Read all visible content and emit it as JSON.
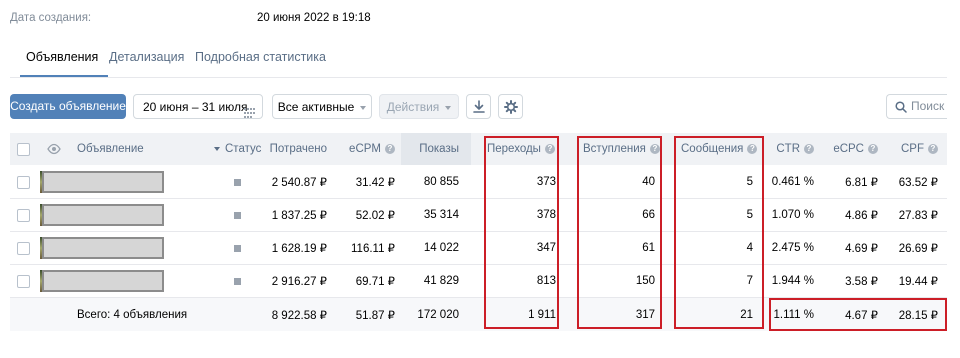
{
  "created": {
    "label": "Дата создания:",
    "value": "20 июня 2022 в 19:18"
  },
  "tabs": [
    {
      "label": "Объявления",
      "active": true
    },
    {
      "label": "Детализация",
      "active": false
    },
    {
      "label": "Подробная статистика",
      "active": false
    }
  ],
  "toolbar": {
    "create_label": "Создать объявление",
    "date_range": "20 июня – 31 июля",
    "filter_label": "Все активные",
    "actions_label": "Действия",
    "search_placeholder": "Поиск о",
    "icons": [
      "calendar-icon",
      "download-icon",
      "settings-icon",
      "search-icon"
    ]
  },
  "table": {
    "headers": {
      "ad": "Объявление",
      "status": "Статус",
      "spent": "Потрачено",
      "ecpm": "eCPM",
      "shows": "Показы",
      "clicks": "Переходы",
      "joins": "Вступления",
      "messages": "Сообщения",
      "ctr": "CTR",
      "ecpc": "eCPC",
      "cpf": "CPF"
    },
    "rows": [
      {
        "spent": "2 540.87 ₽",
        "ecpm": "31.42 ₽",
        "shows": "80 855",
        "clicks": "373",
        "joins": "40",
        "messages": "5",
        "ctr": "0.461 %",
        "ecpc": "6.81 ₽",
        "cpf": "63.52 ₽"
      },
      {
        "spent": "1 837.25 ₽",
        "ecpm": "52.02 ₽",
        "shows": "35 314",
        "clicks": "378",
        "joins": "66",
        "messages": "5",
        "ctr": "1.070 %",
        "ecpc": "4.86 ₽",
        "cpf": "27.83 ₽"
      },
      {
        "spent": "1 628.19 ₽",
        "ecpm": "116.11 ₽",
        "shows": "14 022",
        "clicks": "347",
        "joins": "61",
        "messages": "4",
        "ctr": "2.475 %",
        "ecpc": "4.69 ₽",
        "cpf": "26.69 ₽"
      },
      {
        "spent": "2 916.27 ₽",
        "ecpm": "69.71 ₽",
        "shows": "41 829",
        "clicks": "813",
        "joins": "150",
        "messages": "7",
        "ctr": "1.944 %",
        "ecpc": "3.58 ₽",
        "cpf": "19.44 ₽"
      }
    ],
    "total": {
      "label": "Всего: 4 объявления",
      "spent": "8 922.58 ₽",
      "ecpm": "51.87 ₽",
      "shows": "172 020",
      "clicks": "1 911",
      "joins": "317",
      "messages": "21",
      "ctr": "1.111 %",
      "ecpc": "4.67 ₽",
      "cpf": "28.15 ₽"
    }
  },
  "colors": {
    "accent": "#5181b8",
    "highlight": "#cc1e27"
  }
}
